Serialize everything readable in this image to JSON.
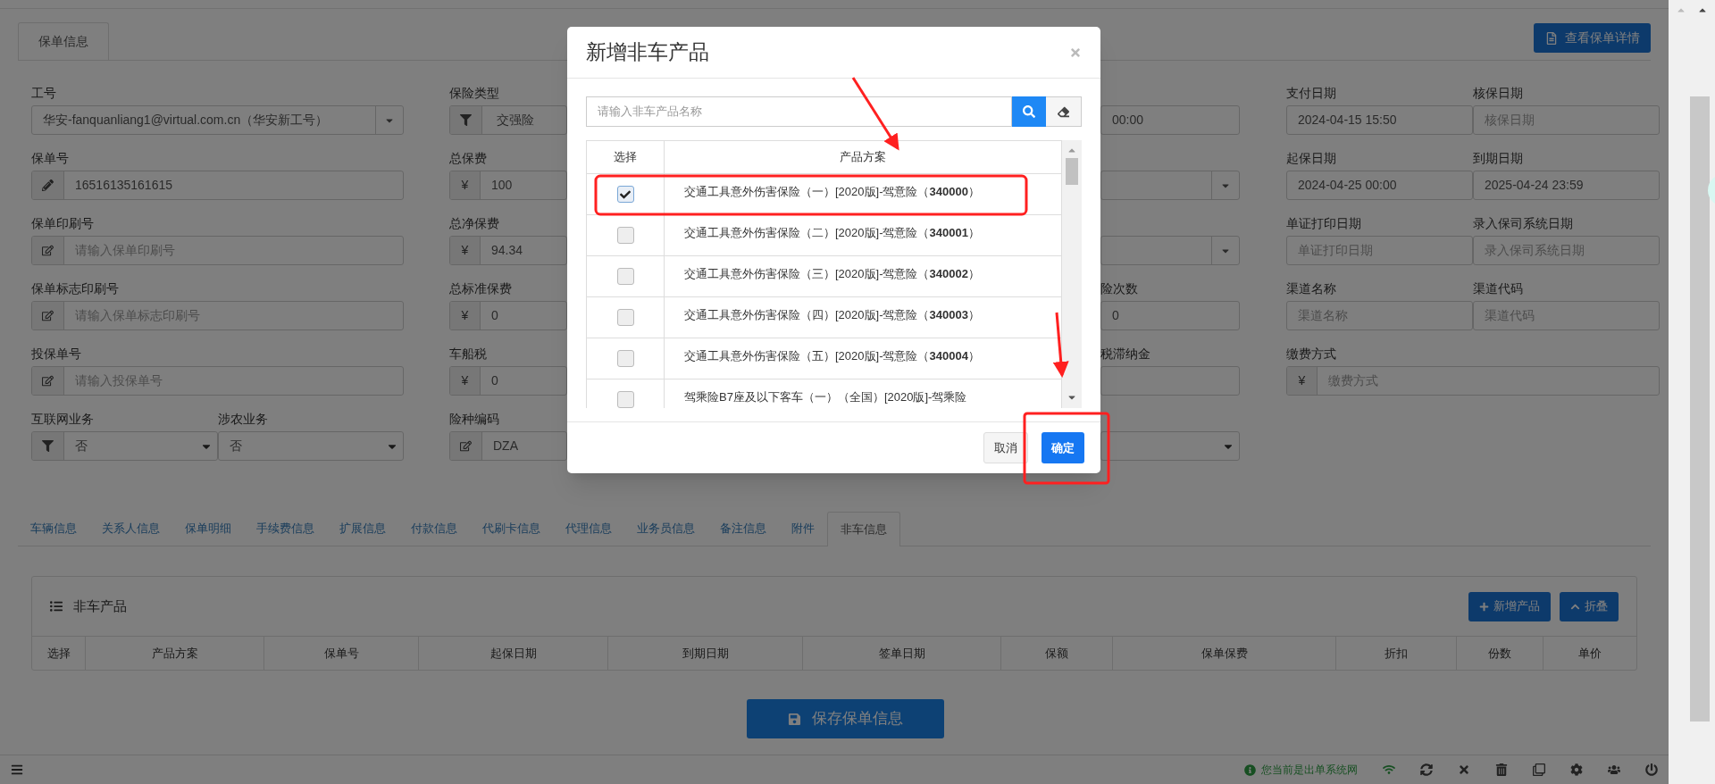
{
  "top_tab": {
    "label": "保单信息",
    "selected": true
  },
  "detail_button": "查看保单详情",
  "form": {
    "column_1": [
      {
        "label": "工号",
        "kind": "caret-select",
        "value": "华安-fanquanliang1@virtual.com.cn（华安新工号）"
      },
      {
        "label": "保单号",
        "kind": "pencil-input",
        "value": "16516135161615"
      },
      {
        "label": "保单印刷号",
        "kind": "edit-input",
        "placeholder": "请输入保单印刷号"
      },
      {
        "label": "保单标志印刷号",
        "kind": "edit-input",
        "placeholder": "请输入保单标志印刷号"
      },
      {
        "label": "投保单号",
        "kind": "edit-input",
        "placeholder": "请输入投保单号"
      },
      {
        "kind": "pair",
        "items": [
          {
            "label": "互联网业务",
            "kind": "filter-select",
            "value": "否"
          },
          {
            "label": "涉农业务",
            "kind": "select",
            "value": "否"
          }
        ]
      }
    ],
    "column_2": [
      {
        "label": "保险类型",
        "kind": "filter-input",
        "value": "交强险"
      },
      {
        "label": "总保费",
        "kind": "currency-input",
        "addon": "¥",
        "value": "100"
      },
      {
        "label": "总净保费",
        "kind": "currency-input",
        "addon": "¥",
        "value": "94.34"
      },
      {
        "label": "总标准保费",
        "kind": "currency-input",
        "addon": "¥",
        "value": "0"
      },
      {
        "label": "车船税",
        "kind": "currency-input",
        "addon": "¥",
        "value": "0"
      },
      {
        "label": "险种编码",
        "kind": "edit-input",
        "value": "DZA"
      }
    ],
    "column_3": [
      {
        "kind": "plain",
        "value": "00:00"
      },
      {
        "kind": "caret-select"
      },
      {
        "kind": "caret-select"
      },
      {
        "label": "险次数",
        "kind": "plain",
        "value": "0"
      },
      {
        "label": "税滞纳金",
        "kind": "plain"
      },
      {
        "kind": "select"
      }
    ],
    "column_4": [
      {
        "kind": "pair",
        "items": [
          {
            "label": "支付日期",
            "kind": "plain",
            "value": "2024-04-15 15:50"
          },
          {
            "label": "核保日期",
            "kind": "plain",
            "placeholder": "核保日期"
          }
        ]
      },
      {
        "kind": "pair",
        "items": [
          {
            "label": "起保日期",
            "kind": "plain",
            "value": "2024-04-25 00:00"
          },
          {
            "label": "到期日期",
            "kind": "plain",
            "value": "2025-04-24 23:59"
          }
        ]
      },
      {
        "kind": "pair",
        "items": [
          {
            "label": "单证打印日期",
            "kind": "plain",
            "placeholder": "单证打印日期"
          },
          {
            "label": "录入保司系统日期",
            "kind": "plain",
            "placeholder": "录入保司系统日期"
          }
        ]
      },
      {
        "kind": "pair",
        "items": [
          {
            "label": "渠道名称",
            "kind": "plain",
            "placeholder": "渠道名称"
          },
          {
            "label": "渠道代码",
            "kind": "plain",
            "placeholder": "渠道代码"
          }
        ]
      },
      {
        "label": "缴费方式",
        "kind": "currency-input",
        "addon": "¥",
        "placeholder": "缴费方式"
      }
    ]
  },
  "bottom_tabs": [
    {
      "label": "车辆信息",
      "selected": false
    },
    {
      "label": "关系人信息",
      "selected": false
    },
    {
      "label": "保单明细",
      "selected": false
    },
    {
      "label": "手续费信息",
      "selected": false
    },
    {
      "label": "扩展信息",
      "selected": false
    },
    {
      "label": "付款信息",
      "selected": false
    },
    {
      "label": "代刷卡信息",
      "selected": false
    },
    {
      "label": "代理信息",
      "selected": false
    },
    {
      "label": "业务员信息",
      "selected": false
    },
    {
      "label": "备注信息",
      "selected": false
    },
    {
      "label": "附件",
      "selected": false
    },
    {
      "label": "非车信息",
      "selected": true
    }
  ],
  "panel": {
    "title": "非车产品",
    "buttons": [
      {
        "kind": "add",
        "label": "新增产品"
      },
      {
        "kind": "collapse",
        "label": "折叠"
      }
    ],
    "columns": [
      "选择",
      "产品方案",
      "保单号",
      "起保日期",
      "到期日期",
      "签单日期",
      "保额",
      "保单保费",
      "折扣",
      "份数",
      "单价"
    ]
  },
  "save_button": "保存保单信息",
  "status_bar": {
    "message": "您当前是出单系统网"
  },
  "modal": {
    "title": "新增非车产品",
    "search": {
      "placeholder": "请输入非车产品名称"
    },
    "columns": [
      "选择",
      "产品方案"
    ],
    "rows": [
      {
        "checked": true,
        "product": "交通工具意外伤害保险（一）[2020版]-驾意险（**340000**）"
      },
      {
        "checked": false,
        "product": "交通工具意外伤害保险（二）[2020版]-驾意险（**340001**）"
      },
      {
        "checked": false,
        "product": "交通工具意外伤害保险（三）[2020版]-驾意险（**340002**）"
      },
      {
        "checked": false,
        "product": "交通工具意外伤害保险（四）[2020版]-驾意险（**340003**）"
      },
      {
        "checked": false,
        "product": "交通工具意外伤害保险（五）[2020版]-驾意险（**340004**）"
      },
      {
        "checked": false,
        "product": "驾乘险B7座及以下客车（一）（全国）[2020版]-驾乘险"
      }
    ],
    "buttons": [
      {
        "kind": "default",
        "label": "取消"
      },
      {
        "kind": "primary",
        "label": "确定"
      }
    ]
  }
}
